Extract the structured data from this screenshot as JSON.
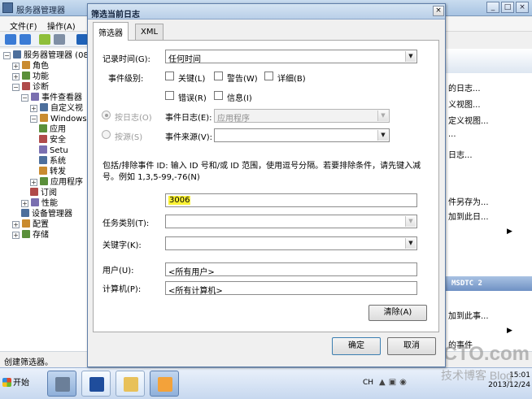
{
  "bg_window": {
    "title": "服务器管理器",
    "menu": [
      "文件(F)",
      "操作(A)"
    ],
    "tree": [
      {
        "label": "服务器管理器 (08S",
        "level": 0,
        "expander": "−"
      },
      {
        "label": "角色",
        "level": 1,
        "expander": "+"
      },
      {
        "label": "功能",
        "level": 1,
        "expander": "+"
      },
      {
        "label": "诊断",
        "level": 1,
        "expander": "−"
      },
      {
        "label": "事件查看器",
        "level": 2,
        "expander": "−"
      },
      {
        "label": "自定义视",
        "level": 3,
        "expander": "+"
      },
      {
        "label": "Windows",
        "level": 3,
        "expander": "−"
      },
      {
        "label": "应用",
        "level": 4,
        "expander": ""
      },
      {
        "label": "安全",
        "level": 4,
        "expander": ""
      },
      {
        "label": "Setu",
        "level": 4,
        "expander": ""
      },
      {
        "label": "系统",
        "level": 4,
        "expander": ""
      },
      {
        "label": "转发",
        "level": 4,
        "expander": ""
      },
      {
        "label": "应用程序",
        "level": 3,
        "expander": "+"
      },
      {
        "label": "订阅",
        "level": 3,
        "expander": ""
      },
      {
        "label": "性能",
        "level": 2,
        "expander": "+"
      },
      {
        "label": "设备管理器",
        "level": 2,
        "expander": ""
      },
      {
        "label": "配置",
        "level": 1,
        "expander": "+"
      },
      {
        "label": "存储",
        "level": 1,
        "expander": "+"
      }
    ],
    "actions": [
      "的日志...",
      "义视图...",
      "定义视图...",
      "...",
      "日志...",
      "件另存为...",
      "加到此日...",
      "",
      "加到此事...",
      "的事件"
    ],
    "actions_header": "MSDTC 2",
    "status": "创建筛选器。"
  },
  "dialog": {
    "title": "筛选当前日志",
    "close_glyph": "×",
    "tabs": [
      "筛选器",
      "XML"
    ],
    "logged_label": "记录时间(G):",
    "logged_value": "任何时间",
    "level_label": "事件级别:",
    "levels": [
      "关键(L)",
      "警告(W)",
      "详细(B)",
      "错误(R)",
      "信息(I)"
    ],
    "by_log_label": "按日志(O)",
    "event_logs_label": "事件日志(E):",
    "event_logs_value": "应用程序",
    "by_source_label": "按源(S)",
    "event_sources_label": "事件来源(V):",
    "event_sources_value": "",
    "help_text": "包括/排除事件 ID: 输入 ID 号和/或 ID 范围，使用逗号分隔。若要排除条件，请先键入减号。例如 1,3,5-99,-76(N)",
    "event_ids_value": "3006",
    "task_category_label": "任务类别(T):",
    "task_category_value": "",
    "keywords_label": "关键字(K):",
    "keywords_value": "",
    "user_label": "用户(U):",
    "user_value": "<所有用户>",
    "computer_label": "计算机(P):",
    "computer_value": "<所有计算机>",
    "clear_label": "清除(A)",
    "ok_label": "确定",
    "cancel_label": "取消"
  },
  "taskbar": {
    "start_label": "开始",
    "lang": "CH",
    "clock_time": "15:01",
    "clock_date": "2013/12/24"
  },
  "watermark": {
    "big": "51CTO.com",
    "small": "技术博客 Blog"
  },
  "colors": {
    "event_id_highlight": "#fbf235",
    "dialog_title_bar": "#c7d9ee",
    "actions_header": "#6f91c4"
  }
}
